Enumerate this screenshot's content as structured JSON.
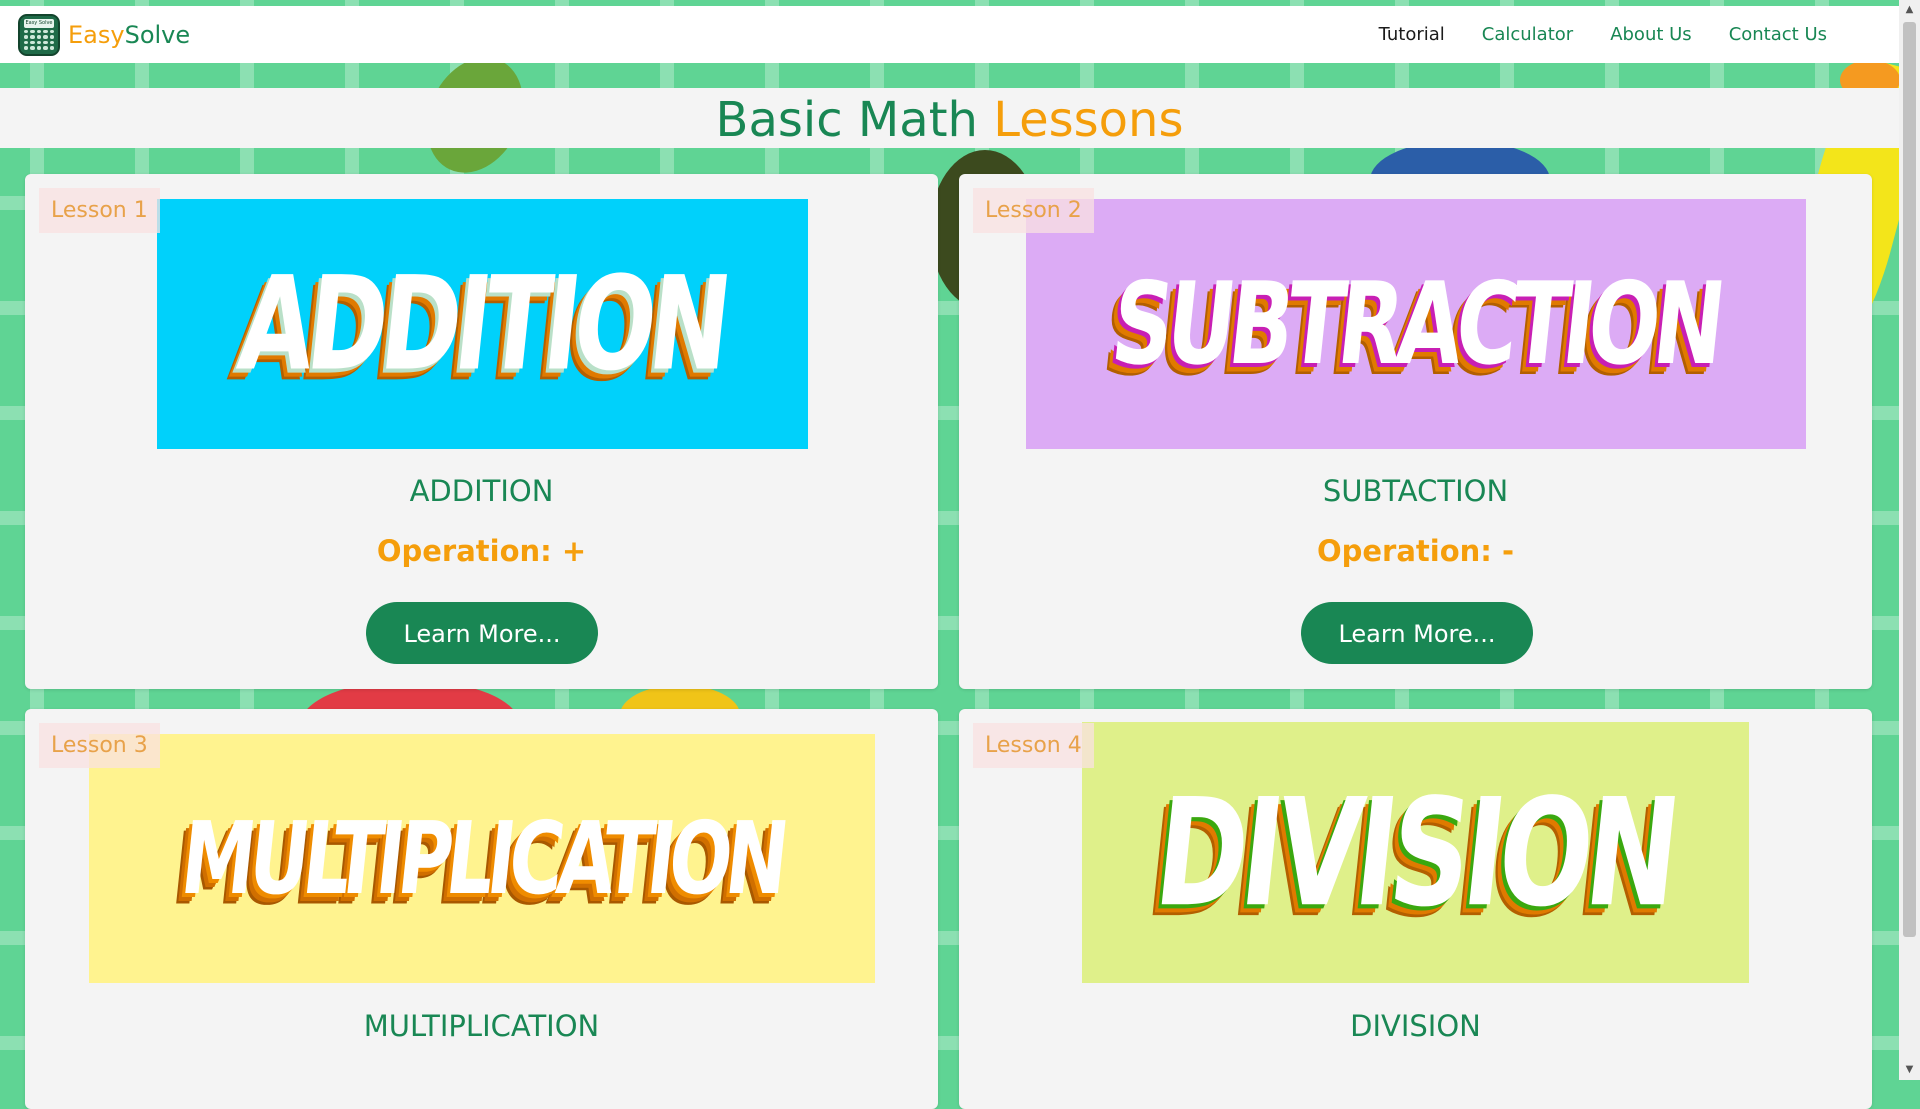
{
  "brand": {
    "easy": "Easy",
    "solve": "Solve",
    "logo_text": "Easy Solve",
    "logo_icon": "calculator-icon"
  },
  "nav": [
    {
      "label": "Tutorial",
      "active": true
    },
    {
      "label": "Calculator",
      "active": false
    },
    {
      "label": "About Us",
      "active": false
    },
    {
      "label": "Contact Us",
      "active": false
    }
  ],
  "heading": {
    "part1": "Basic Math",
    "part2": "Lessons"
  },
  "lessons": [
    {
      "badge": "Lesson 1",
      "banner_word": "ADDITION",
      "banner_bg": "#00d1fb",
      "banner_outline": "#e07a00",
      "name": "ADDITION",
      "operation": "Operation: +",
      "button": "Learn More..."
    },
    {
      "badge": "Lesson 2",
      "banner_word": "SUBTRACTION",
      "banner_bg": "#dcabf5",
      "banner_outline": "#c81fb4",
      "name": "SUBTACTION",
      "operation": "Operation: -",
      "button": "Learn More..."
    },
    {
      "badge": "Lesson 3",
      "banner_word": "MULTIPLICATION",
      "banner_bg": "#fff38f",
      "banner_outline": "#ef8c00",
      "name": "MULTIPLICATION",
      "operation": "",
      "button": ""
    },
    {
      "badge": "Lesson 4",
      "banner_word": "DIVISION",
      "banner_bg": "#dff08a",
      "banner_outline": "#3aa80f",
      "name": "DIVISION",
      "operation": "",
      "button": ""
    }
  ],
  "colors": {
    "primary": "#198754",
    "accent": "#f59e0b",
    "background": "#5fd494"
  }
}
